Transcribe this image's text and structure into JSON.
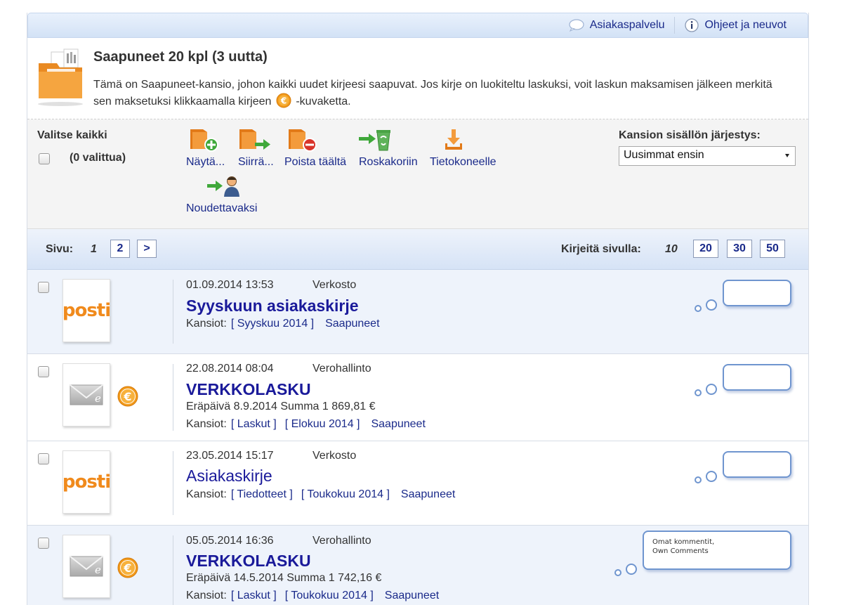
{
  "topbar": {
    "customer_service": "Asiakaspalvelu",
    "help": "Ohjeet ja neuvot"
  },
  "intro": {
    "title": "Saapuneet 20 kpl (3 uutta)",
    "desc_part1": "Tämä on Saapuneet-kansio, johon kaikki uudet kirjeesi saapuvat. Jos kirje on luokiteltu laskuksi, voit laskun maksamisen jälkeen merkitä sen maksetuksi klikkaamalla kirjeen",
    "desc_part2": "-kuvaketta."
  },
  "toolbar": {
    "select_all": "Valitse kaikki",
    "selected_count": "(0 valittua)",
    "actions": [
      "Näytä...",
      "Siirrä...",
      "Poista täältä",
      "Roskakoriin",
      "Tietokoneelle",
      "Noudettavaksi"
    ],
    "sort_label": "Kansion sisällön järjestys:",
    "sort_value": "Uusimmat ensin"
  },
  "pager": {
    "page_label": "Sivu:",
    "current_page": "1",
    "pages": [
      "2",
      ">"
    ],
    "per_page_label": "Kirjeitä sivulla:",
    "current_per_page": "10",
    "per_page_options": [
      "20",
      "30",
      "50"
    ]
  },
  "letters": [
    {
      "date": "01.09.2014 13:53",
      "sender": "Verkosto",
      "subject": "Syyskuun asiakaskirje",
      "logo": "posti",
      "info": "",
      "folders_label": "Kansiot:",
      "folders": [
        "[ Syyskuu 2014 ]",
        "Saapuneet"
      ],
      "comment": ""
    },
    {
      "date": "22.08.2014 08:04",
      "sender": "Verohallinto",
      "subject": "VERKKOLASKU",
      "logo": "e-letter",
      "info": "Eräpäivä 8.9.2014 Summa   1 869,81 €",
      "folders_label": "Kansiot:",
      "folders": [
        "[ Laskut ]",
        "[ Elokuu 2014 ]",
        "Saapuneet"
      ],
      "comment": ""
    },
    {
      "date": "23.05.2014 15:17",
      "sender": "Verkosto",
      "subject": "Asiakaskirje",
      "logo": "posti",
      "info": "",
      "folders_label": "Kansiot:",
      "folders": [
        "[ Tiedotteet ]",
        "[ Toukokuu 2014 ]",
        "Saapuneet"
      ],
      "comment": ""
    },
    {
      "date": "05.05.2014 16:36",
      "sender": "Verohallinto",
      "subject": "VERKKOLASKU",
      "logo": "e-letter",
      "info": "Eräpäivä 14.5.2014 Summa  1 742,16 €",
      "folders_label": "Kansiot:",
      "folders": [
        "[ Laskut ]",
        "[ Toukokuu 2014 ]",
        "Saapuneet"
      ],
      "comment": "Omat kommentit,\nOwn Comments"
    }
  ],
  "logo_text": "posti",
  "euro_symbol": "€",
  "colors": {
    "link": "#1a2a8a",
    "subject": "#1a1a9a",
    "posti_orange": "#f08a1c",
    "euro_orange": "#f29a1a",
    "comment_border": "#6f95cf"
  }
}
